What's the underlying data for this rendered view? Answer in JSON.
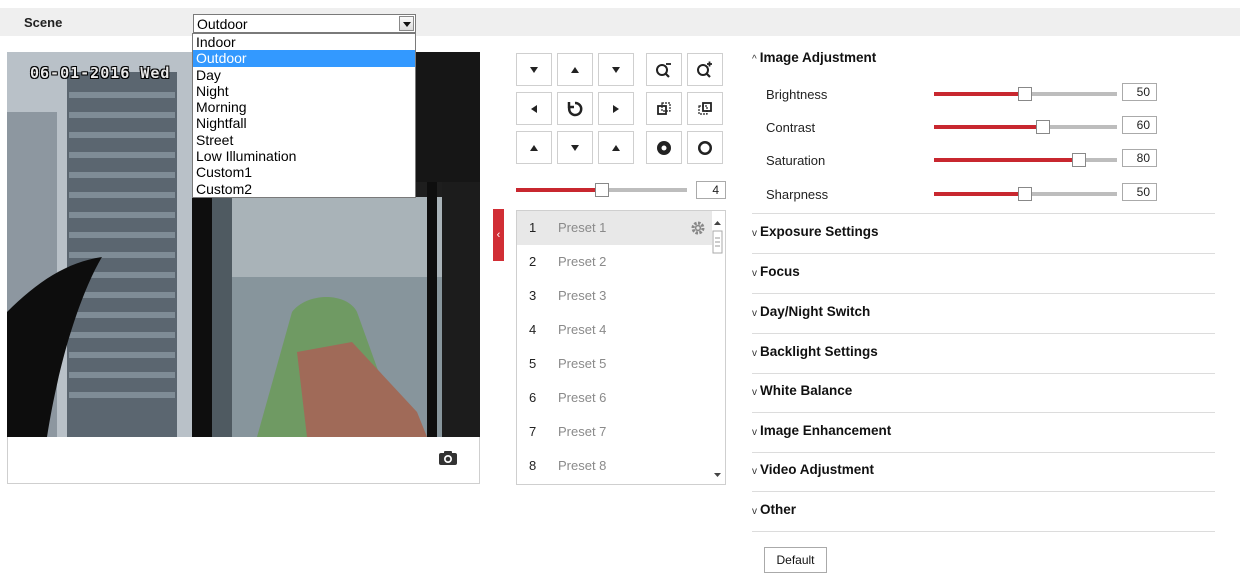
{
  "scene": {
    "label": "Scene",
    "selected": "Outdoor",
    "options": [
      "Indoor",
      "Outdoor",
      "Day",
      "Night",
      "Morning",
      "Nightfall",
      "Street",
      "Low Illumination",
      "Custom1",
      "Custom2"
    ],
    "highlighted_index": 1
  },
  "video": {
    "osd_text": "06-01-2016 Wed"
  },
  "ptz": {
    "speed_value": "4",
    "speed_fraction": 0.5
  },
  "presets": [
    {
      "num": "1",
      "name": "Preset 1"
    },
    {
      "num": "2",
      "name": "Preset 2"
    },
    {
      "num": "3",
      "name": "Preset 3"
    },
    {
      "num": "4",
      "name": "Preset 4"
    },
    {
      "num": "5",
      "name": "Preset 5"
    },
    {
      "num": "6",
      "name": "Preset 6"
    },
    {
      "num": "7",
      "name": "Preset 7"
    },
    {
      "num": "8",
      "name": "Preset 8"
    }
  ],
  "image_adjustment": {
    "title": "Image Adjustment",
    "sliders": [
      {
        "label": "Brightness",
        "value": "50",
        "fraction": 0.5
      },
      {
        "label": "Contrast",
        "value": "60",
        "fraction": 0.6
      },
      {
        "label": "Saturation",
        "value": "80",
        "fraction": 0.8
      },
      {
        "label": "Sharpness",
        "value": "50",
        "fraction": 0.5
      }
    ]
  },
  "sections": [
    "Exposure Settings",
    "Focus",
    "Day/Night Switch",
    "Backlight Settings",
    "White Balance",
    "Image Enhancement",
    "Video Adjustment",
    "Other"
  ],
  "default_label": "Default",
  "colors": {
    "accent": "#c8272f",
    "selection": "#3399ff"
  }
}
